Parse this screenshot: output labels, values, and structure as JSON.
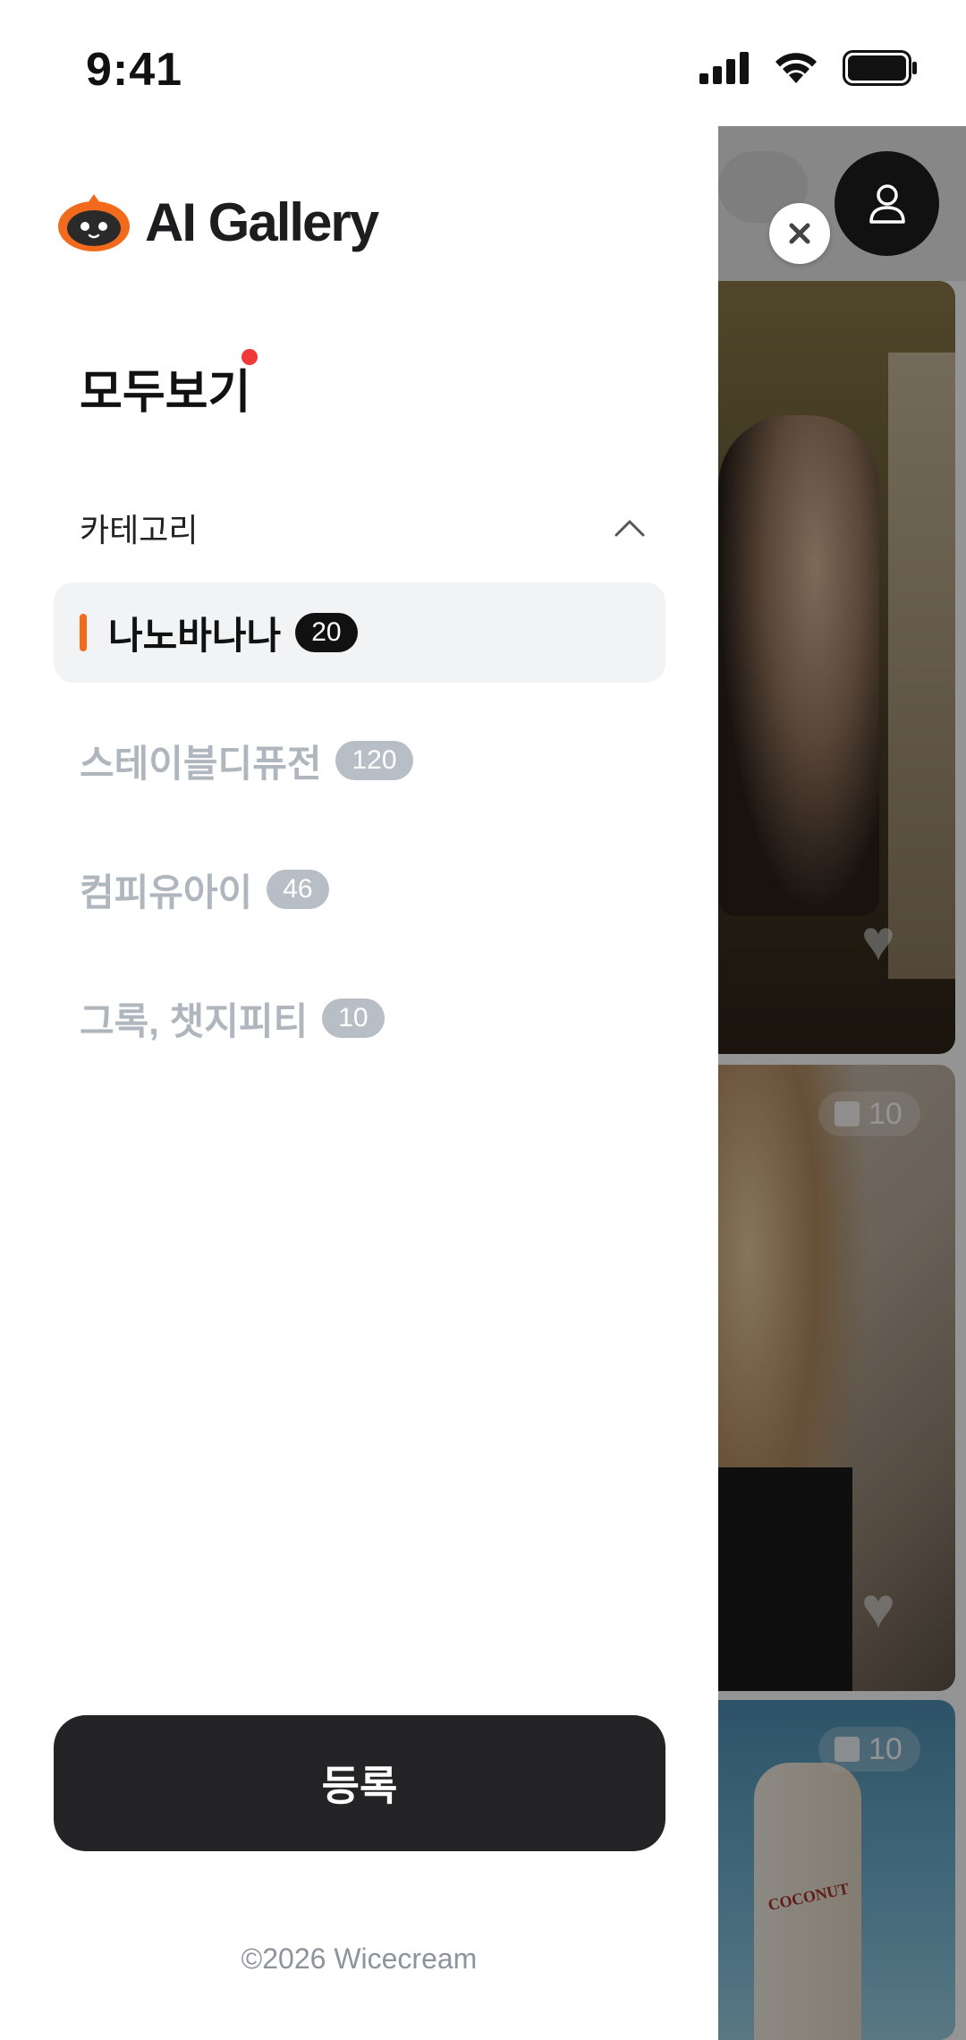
{
  "status_bar": {
    "time": "9:41"
  },
  "app": {
    "title": "AI Gallery"
  },
  "menu": {
    "view_all_label": "모두보기",
    "category_title": "카테고리",
    "categories": [
      {
        "label": "나노바나나",
        "count": "20",
        "active": true
      },
      {
        "label": "스테이블디퓨전",
        "count": "120",
        "active": false
      },
      {
        "label": "컴피유아이",
        "count": "46",
        "active": false
      },
      {
        "label": "그록, 챗지피티",
        "count": "10",
        "active": false
      }
    ],
    "register_label": "등록",
    "copyright": "©2026 Wicecream"
  },
  "gallery": {
    "cards": [
      {
        "image_count": ""
      },
      {
        "image_count": "10"
      },
      {
        "image_count": "10",
        "label_text": "COCONUT"
      }
    ]
  },
  "colors": {
    "accent": "#f26a1b",
    "notification_dot": "#f03a3a",
    "primary_button": "#242426",
    "active_item_bg": "#f1f3f5",
    "inactive_text": "#b0b6bd"
  },
  "icons": [
    "signal-icon",
    "wifi-icon",
    "battery-icon",
    "logo-icon",
    "chevron-up-icon",
    "close-icon",
    "user-icon",
    "heart-icon",
    "image-stack-icon"
  ]
}
